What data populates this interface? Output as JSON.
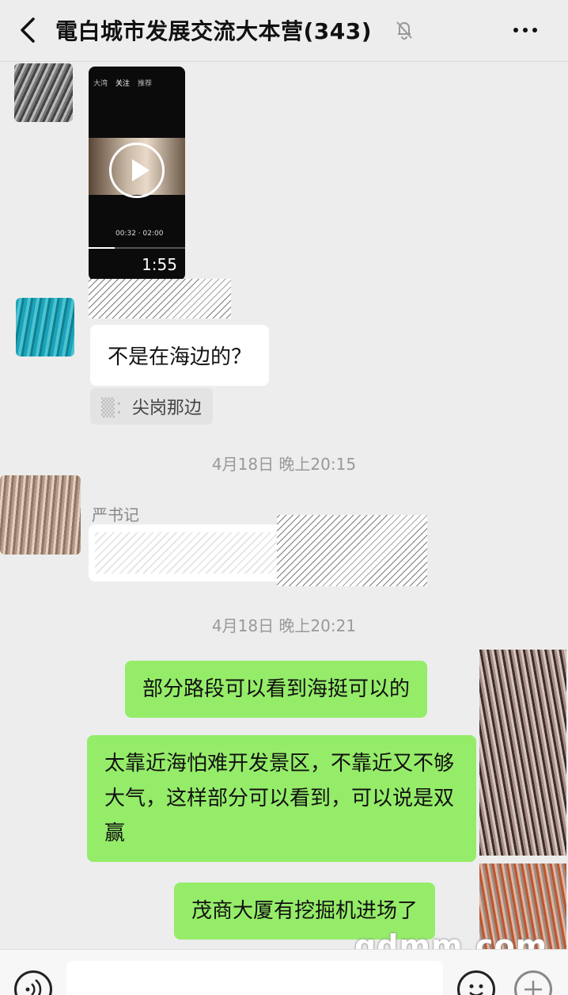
{
  "header": {
    "title": "電白城市发展交流大本营(343)",
    "back_icon": "chevron-left-icon",
    "mute_icon": "bell-muted-icon",
    "more_icon": "more-dots-icon"
  },
  "video_message": {
    "tabs": [
      "大湾",
      "关注",
      "推荐"
    ],
    "current_time": "00:32",
    "total_time": "02:00",
    "duration": "1:55",
    "progress_fraction": 0.27
  },
  "messages": {
    "incoming_1": {
      "text": "不是在海边的？",
      "quote": "尖岗那边"
    },
    "timestamp_1": "4月18日 晚上20:15",
    "incoming_2": {
      "sender": "严书记"
    },
    "timestamp_2": "4月18日 晚上20:21",
    "outgoing_1": "部分路段可以看到海挺可以的",
    "outgoing_2": "太靠近海怕难开发景区，不靠近又不够大气，这样部分可以看到，可以说是双赢",
    "outgoing_3": "茂商大厦有挖掘机进场了"
  },
  "watermark": "gdmm.com",
  "colors": {
    "outgoing_bubble": "#95ec69",
    "incoming_bubble": "#ffffff",
    "background": "#ededed"
  }
}
